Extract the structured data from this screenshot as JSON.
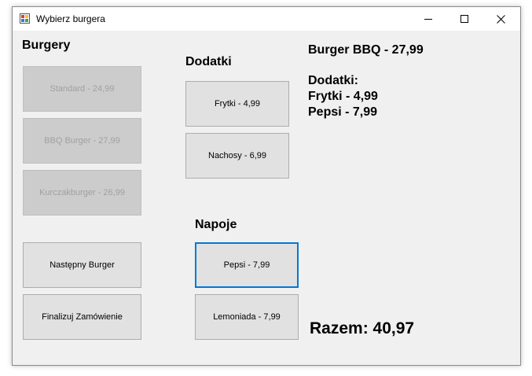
{
  "window": {
    "title": "Wybierz burgera",
    "icon": "app-window-icon",
    "controls": [
      "minimize-icon",
      "maximize-icon",
      "close-icon"
    ]
  },
  "burgers": {
    "heading": "Burgery",
    "items": [
      {
        "label": "Standard - 24,99",
        "enabled": false
      },
      {
        "label": "BBQ Burger - 27,99",
        "enabled": false
      },
      {
        "label": "Kurczakburger - 26,99",
        "enabled": false
      }
    ],
    "next_label": "Następny Burger",
    "finalize_label": "Finalizuj Zamówienie"
  },
  "extras": {
    "heading": "Dodatki",
    "items": [
      {
        "label": "Frytki - 4,99"
      },
      {
        "label": "Nachosy - 6,99"
      }
    ]
  },
  "drinks": {
    "heading": "Napoje",
    "items": [
      {
        "label": "Pepsi - 7,99",
        "focused": true
      },
      {
        "label": "Lemoniada - 7,99"
      }
    ]
  },
  "summary": {
    "burger": "Burger BBQ - 27,99",
    "extras_header": "Dodatki:",
    "extras": [
      "Frytki - 4,99",
      "Pepsi - 7,99"
    ],
    "total": "Razem: 40,97"
  },
  "colors": {
    "focus_border": "#0078d7",
    "button_bg": "#e1e1e1",
    "disabled_bg": "#cccccc",
    "disabled_text": "#a0a0a0",
    "window_bg": "#f0f0f0"
  }
}
